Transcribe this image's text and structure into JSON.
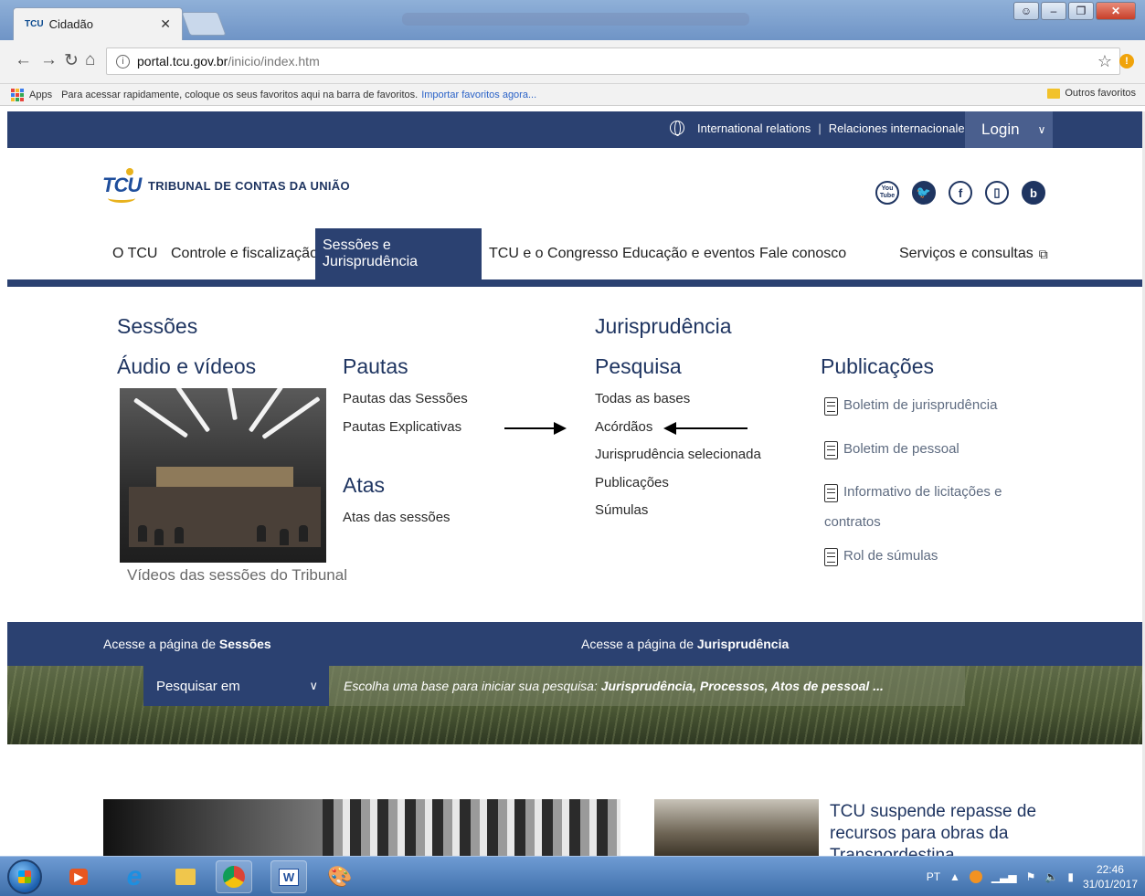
{
  "browser": {
    "tab_title": "Cidadão",
    "tab_favicon": "TCU",
    "url_host": "portal.tcu.gov.br",
    "url_path": "/inicio/index.htm",
    "bookmarks_apps": "Apps",
    "bookmarks_hint": "Para acessar rapidamente, coloque os seus favoritos aqui na barra de favoritos.",
    "bookmarks_import": "Importar favoritos agora...",
    "other_bookmarks": "Outros favoritos"
  },
  "topbar": {
    "intl_en": "International relations",
    "intl_es": "Relaciones internacionales",
    "login": "Login"
  },
  "header": {
    "logo_mark": "TCU",
    "org_name": "TRIBUNAL DE CONTAS DA UNIÃO",
    "social": [
      "You Tube",
      "twitter",
      "f",
      "phone",
      "blog"
    ]
  },
  "nav": {
    "items": [
      "O TCU",
      "Controle e fiscalização",
      "Sessões e Jurisprudência",
      "TCU e o Congresso",
      "Educação e eventos",
      "Fale conosco",
      "Serviços e consultas"
    ]
  },
  "menu": {
    "sessoes": "Sessões",
    "audio_videos": "Áudio e vídeos",
    "video_caption": "Vídeos das sessões do Tribunal",
    "pautas": "Pautas",
    "pautas_links": [
      "Pautas das Sessões",
      "Pautas Explicativas"
    ],
    "atas": "Atas",
    "atas_links": [
      "Atas das sessões"
    ],
    "jurisprudencia": "Jurisprudência",
    "pesquisa": "Pesquisa",
    "pesquisa_links": [
      "Todas as bases",
      "Acórdãos",
      "Jurisprudência selecionada",
      "Publicações",
      "Súmulas"
    ],
    "publicacoes": "Publicações",
    "publicacoes_links": [
      "Boletim de jurisprudência",
      "Boletim de pessoal",
      "Informativo de licitações e",
      "contratos",
      "Rol de súmulas"
    ]
  },
  "access": {
    "sessoes_prefix": "Acesse a página de ",
    "sessoes_bold": "Sessões",
    "jur_prefix": "Acesse a página de ",
    "jur_bold": "Jurisprudência"
  },
  "search": {
    "select_label": "Pesquisar em",
    "placeholder_prefix": "Escolha uma base para iniciar sua pesquisa: ",
    "placeholder_bold": "Jurisprudência, Processos, Atos de pessoal ..."
  },
  "news": {
    "title": "TCU suspende repasse de recursos para obras da Transnordestina"
  },
  "taskbar": {
    "lang": "PT",
    "time": "22:46",
    "date": "31/01/2017"
  }
}
